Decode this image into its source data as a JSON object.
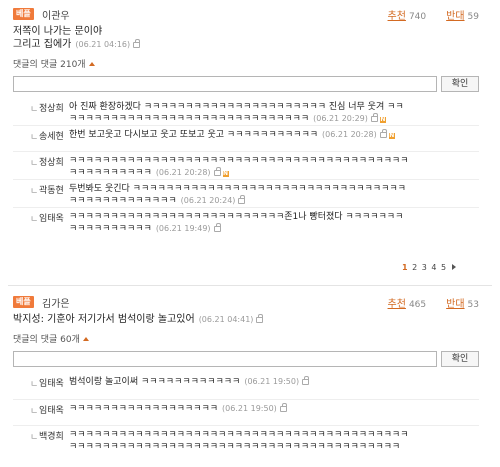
{
  "comments": [
    {
      "badge": "베플",
      "author": "이관우",
      "up_label": "추천",
      "up_count": "740",
      "down_label": "반대",
      "down_count": "59",
      "text_line1": "저쪽이 나가는 문이야",
      "text_line2": "그리고 집에가",
      "time": "(06.21 04:16)",
      "reply_count_label": "댓글의 댓글 210개",
      "submit_label": "확인",
      "replies": [
        {
          "mark": "ㄴ",
          "name": "정상희",
          "text": "아 진짜 환장하겠다 ㅋㅋㅋㅋㅋㅋㅋㅋㅋㅋㅋㅋㅋㅋㅋㅋㅋㅋㅋㅋㅋㅋ 진심 너무 웃겨 ㅋㅋㅋㅋㅋㅋㅋㅋㅋㅋㅋㅋㅋㅋㅋㅋㅋㅋㅋㅋㅋㅋㅋㅋㅋㅋㅋㅋㅋㅋㅋ",
          "time": "(06.21 20:29)"
        },
        {
          "mark": "ㄴ",
          "name": "송세현",
          "text": "한번 보고웃고 다시보고 웃고 또보고 웃고 ㅋㅋㅋㅋㅋㅋㅋㅋㅋㅋㅋ",
          "time": "(06.21 20:28)"
        },
        {
          "mark": "ㄴ",
          "name": "정상희",
          "text": "ㅋㅋㅋㅋㅋㅋㅋㅋㅋㅋㅋㅋㅋㅋㅋㅋㅋㅋㅋㅋㅋㅋㅋㅋㅋㅋㅋㅋㅋㅋㅋㅋㅋㅋㅋㅋㅋㅋㅋㅋㅋㅋㅋㅋㅋㅋㅋㅋㅋㅋㅋ",
          "time": "(06.21 20:28)"
        },
        {
          "mark": "ㄴ",
          "name": "곽동현",
          "text": "두번봐도 웃긴다 ㅋㅋㅋㅋㅋㅋㅋㅋㅋㅋㅋㅋㅋㅋㅋㅋㅋㅋㅋㅋㅋㅋㅋㅋㅋㅋㅋㅋㅋㅋㅋㅋㅋㅋㅋㅋㅋㅋㅋㅋㅋㅋㅋㅋㅋㅋ",
          "time": "(06.21 20:24)"
        },
        {
          "mark": "ㄴ",
          "name": "임태옥",
          "text": "ㅋㅋㅋㅋㅋㅋㅋㅋㅋㅋㅋㅋㅋㅋㅋㅋㅋㅋㅋㅋㅋㅋㅋㅋㅋㅋ존1나 빵터졌다 ㅋㅋㅋㅋㅋㅋㅋㅋㅋㅋㅋㅋㅋㅋㅋㅋㅋ",
          "time": "(06.21 19:49)"
        }
      ]
    },
    {
      "badge": "베플",
      "author": "김가은",
      "up_label": "추천",
      "up_count": "465",
      "down_label": "반대",
      "down_count": "53",
      "text_line1": "박지성: 기훈아 저기가서 범석이랑 놀고있어",
      "time": "(06.21 04:41)",
      "reply_count_label": "댓글의 댓글 60개",
      "submit_label": "확인",
      "replies": [
        {
          "mark": "ㄴ",
          "name": "임태옥",
          "text": "범석이랑 놀고이써 ㅋㅋㅋㅋㅋㅋㅋㅋㅋㅋㅋㅋ",
          "time": "(06.21 19:50)"
        },
        {
          "mark": "ㄴ",
          "name": "임태옥",
          "text": "ㅋㅋㅋㅋㅋㅋㅋㅋㅋㅋㅋㅋㅋㅋㅋㅋㅋㅋ",
          "time": "(06.21 19:50)"
        },
        {
          "mark": "ㄴ",
          "name": "백경희",
          "text": "ㅋㅋㅋㅋㅋㅋㅋㅋㅋㅋㅋㅋㅋㅋㅋㅋㅋㅋㅋㅋㅋㅋㅋㅋㅋㅋㅋㅋㅋㅋㅋㅋㅋㅋㅋㅋㅋㅋㅋㅋㅋㅋㅋㅋㅋㅋㅋㅋㅋㅋㅋㅋㅋㅋㅋㅋㅋㅋㅋㅋㅋㅋㅋㅋㅋㅋㅋㅋㅋㅋㅋㅋㅋㅋㅋㅋㅋㅋㅋㅋㅋ",
          "time": ""
        }
      ]
    }
  ],
  "pagination": {
    "pages": [
      "1",
      "2",
      "3",
      "4",
      "5"
    ],
    "current": "1"
  },
  "colors": {
    "accent": "#d36a22",
    "badge": "#f07a3a",
    "new_icon": "#f0a030"
  },
  "icons": {
    "lock": "lock-icon",
    "new": "new-icon",
    "arrow": "caret-up-icon",
    "next": "next-page-icon"
  }
}
